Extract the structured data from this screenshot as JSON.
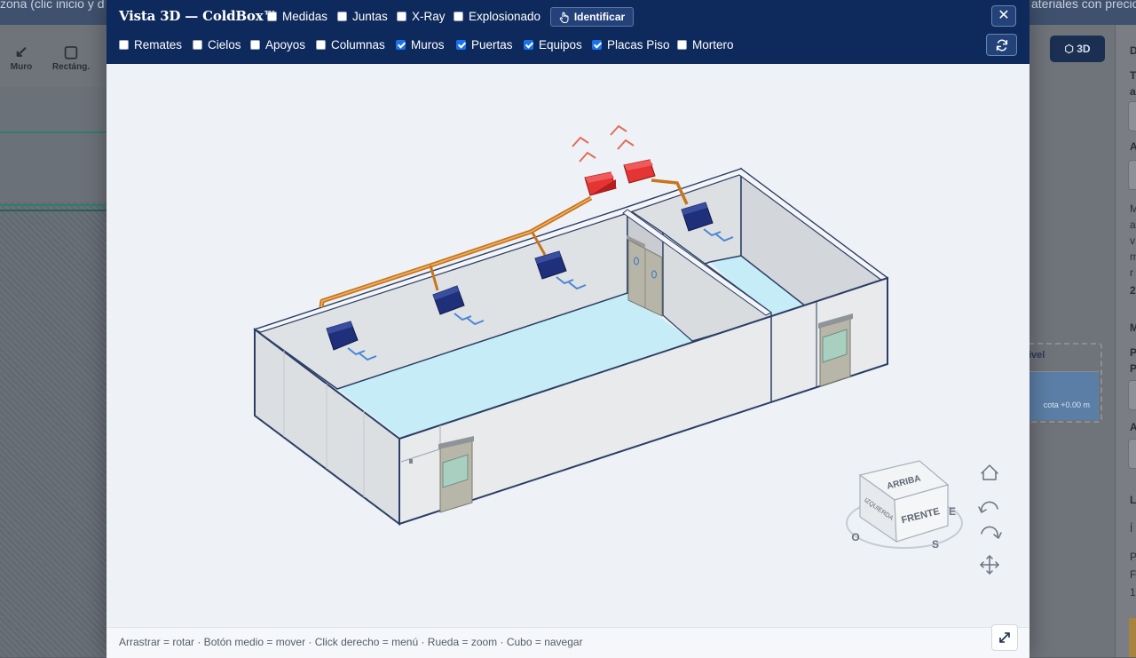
{
  "background": {
    "topbar_left": "zona (clic inicio y d",
    "topbar_right": "ateriales con precio",
    "tools": [
      {
        "label": "Muro",
        "icon": "↙"
      },
      {
        "label": "Rectáng.",
        "icon": "▢"
      }
    ],
    "btn_3d": "3D",
    "panel_letters": [
      "D",
      "T",
      "a",
      "A",
      "M",
      "a",
      "v",
      "m",
      "r",
      "2",
      "M",
      "P",
      "P",
      "A",
      "L",
      "Í",
      "P",
      "F",
      "1"
    ],
    "nivel_label": "ivel",
    "cota_label": "cota +0.00 m"
  },
  "modal": {
    "title": "Vista 3D — ColdBox™",
    "identify_label": "Identificar",
    "row1": [
      {
        "label": "Medidas",
        "checked": false
      },
      {
        "label": "Juntas",
        "checked": false
      },
      {
        "label": "X-Ray",
        "checked": false
      },
      {
        "label": "Explosionado",
        "checked": false
      }
    ],
    "row2": [
      {
        "label": "Remates",
        "checked": false
      },
      {
        "label": "Cielos",
        "checked": false
      },
      {
        "label": "Apoyos",
        "checked": false
      },
      {
        "label": "Columnas",
        "checked": false
      },
      {
        "label": "Muros",
        "checked": true
      },
      {
        "label": "Puertas",
        "checked": true
      },
      {
        "label": "Equipos",
        "checked": true
      },
      {
        "label": "Placas Piso",
        "checked": true
      },
      {
        "label": "Mortero",
        "checked": false
      }
    ],
    "footer_hint": "Arrastrar = rotar · Botón medio = mover · Click derecho = menú · Rueda = zoom · Cubo = navegar"
  },
  "nav_cube": {
    "top": "ARRIBA",
    "front": "FRENTE",
    "left": "IZQUIERDA",
    "compass": {
      "east": "E",
      "west": "O",
      "south": "S"
    }
  },
  "icons": {
    "close": "close-icon",
    "refresh": "refresh-icon",
    "identify": "hand-pointer-icon",
    "home": "home-icon",
    "rotate_left": "rotate-left-icon",
    "rotate_right": "rotate-right-icon",
    "pan": "pan-arrows-icon",
    "expand": "expand-icon"
  },
  "colors": {
    "header": "#0e2a5c",
    "checkbox_on": "#1a73e8",
    "floor": "#c4ecf6",
    "evaporator": "#1f2f7a",
    "condenser": "#d92b2b",
    "pipe": "#d08a3a"
  }
}
